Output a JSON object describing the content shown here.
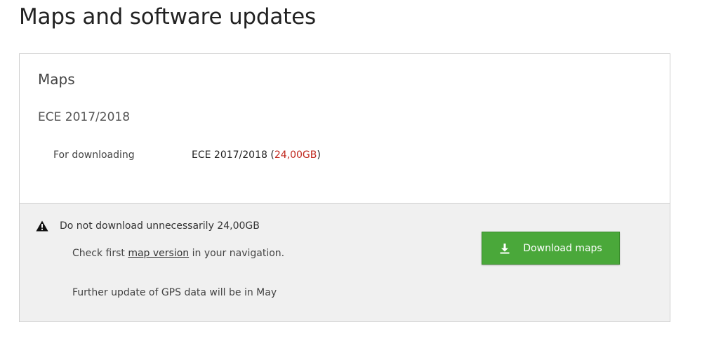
{
  "page": {
    "title": "Maps and software updates"
  },
  "maps": {
    "heading": "Maps",
    "map_name": "ECE 2017/2018",
    "download_label": "For downloading",
    "download_value": "ECE 2017/2018 (",
    "download_size": "24,00GB",
    "download_value_close": ")"
  },
  "notice": {
    "warning_icon": "warning-icon",
    "title": "Do not download unnecessarily 24,00GB",
    "check_prefix": "Check first ",
    "check_link": "map version",
    "check_suffix": " in your navigation.",
    "update_text": "Further update of GPS data will be in May"
  },
  "actions": {
    "download_button_label": "Download maps",
    "download_icon": "download-icon"
  },
  "colors": {
    "button_green": "#4aa83a",
    "size_red": "#c0281e",
    "notice_background": "#f0f0f0"
  }
}
